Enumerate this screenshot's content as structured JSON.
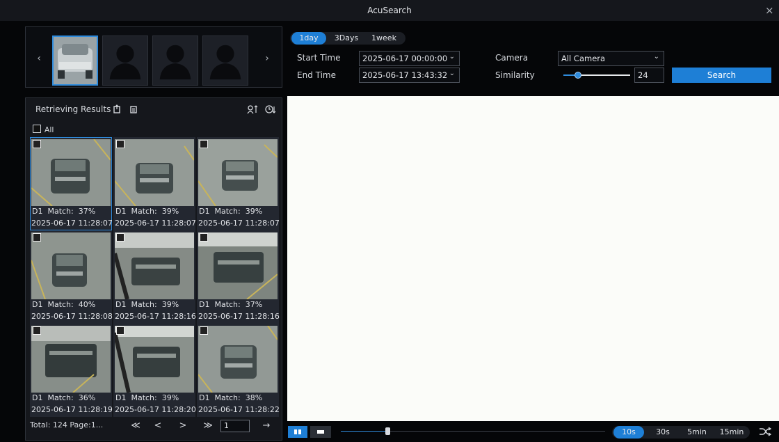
{
  "window": {
    "title": "AcuSearch",
    "close_glyph": "×"
  },
  "target_strip": {
    "prev_glyph": "‹",
    "next_glyph": "›",
    "thumbnails": [
      "car",
      "person",
      "person",
      "person"
    ]
  },
  "results": {
    "title": "Retrieving Results",
    "select_all_label": "All",
    "items": [
      {
        "channel": "D1",
        "match": "Match:  37%",
        "time": "2025-06-17 11:28:07"
      },
      {
        "channel": "D1",
        "match": "Match:  39%",
        "time": "2025-06-17 11:28:07"
      },
      {
        "channel": "D1",
        "match": "Match:  39%",
        "time": "2025-06-17 11:28:07"
      },
      {
        "channel": "D1",
        "match": "Match:  40%",
        "time": "2025-06-17 11:28:08"
      },
      {
        "channel": "D1",
        "match": "Match:  39%",
        "time": "2025-06-17 11:28:16"
      },
      {
        "channel": "D1",
        "match": "Match:  37%",
        "time": "2025-06-17 11:28:16"
      },
      {
        "channel": "D1",
        "match": "Match:  36%",
        "time": "2025-06-17 11:28:19"
      },
      {
        "channel": "D1",
        "match": "Match:  39%",
        "time": "2025-06-17 11:28:20"
      },
      {
        "channel": "D1",
        "match": "Match:  38%",
        "time": "2025-06-17 11:28:22"
      }
    ],
    "pager": {
      "total_label": "Total: 124  Page:1...",
      "first": "≪",
      "prev": "<",
      "next": ">",
      "last": "≫",
      "page_value": "1",
      "go": "→"
    }
  },
  "search": {
    "ranges": [
      "1day",
      "3Days",
      "1week"
    ],
    "active_range": "1day",
    "start_time_label": "Start Time",
    "start_time_value": "2025-06-17 00:00:00",
    "end_time_label": "End Time",
    "end_time_value": "2025-06-17 13:43:32",
    "camera_label": "Camera",
    "camera_value": "All Camera",
    "similarity_label": "Similarity",
    "similarity_value": "24",
    "search_button": "Search"
  },
  "playback": {
    "zoom_options": [
      "10s",
      "30s",
      "5min",
      "15min"
    ],
    "active_zoom": "10s"
  },
  "colors": {
    "accent": "#1e7fd6",
    "panel": "#15171c",
    "background": "#050608",
    "video": "#fbfcf9"
  },
  "icons": [
    "export-icon",
    "backup-icon",
    "sort-by-similarity-icon",
    "sort-by-time-icon",
    "layout-split-icon",
    "layout-single-icon",
    "shuffle-icon"
  ]
}
